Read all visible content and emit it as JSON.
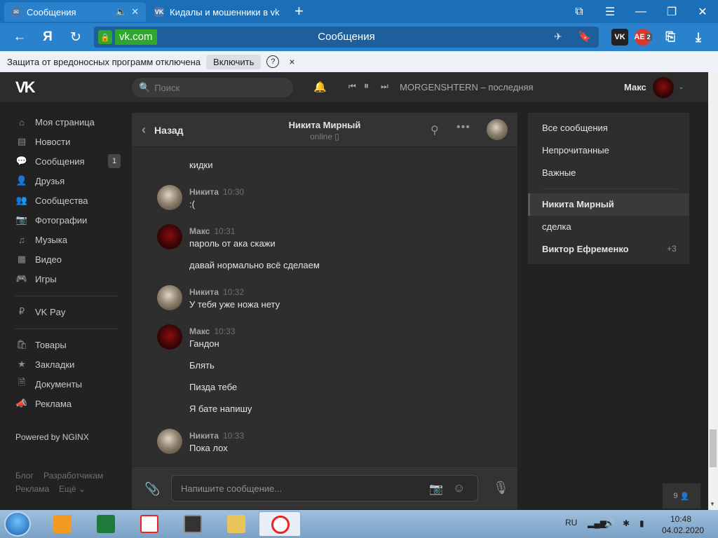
{
  "browser": {
    "tabs": [
      {
        "label": "Сообщения",
        "close": "✕"
      },
      {
        "label": "Кидалы и мошенники в vk"
      }
    ],
    "new_tab": "+",
    "logo": "Я",
    "url_domain": "vk.com",
    "page_title": "Сообщения",
    "ext_badge": "2",
    "ext_label": "AE"
  },
  "notice": {
    "text": "Защита от вредоносных программ отключена",
    "enable": "Включить",
    "help": "?",
    "close": "×"
  },
  "vk_header": {
    "search_placeholder": "Поиск",
    "track": "MORGENSHTERN – последняя",
    "user": "Макс"
  },
  "left_menu": {
    "items": [
      {
        "label": "Моя страница",
        "icon": "home-icon"
      },
      {
        "label": "Новости",
        "icon": "news-icon"
      },
      {
        "label": "Сообщения",
        "icon": "messages-icon",
        "badge": "1"
      },
      {
        "label": "Друзья",
        "icon": "friends-icon"
      },
      {
        "label": "Сообщества",
        "icon": "communities-icon"
      },
      {
        "label": "Фотографии",
        "icon": "photos-icon"
      },
      {
        "label": "Музыка",
        "icon": "music-icon"
      },
      {
        "label": "Видео",
        "icon": "video-icon"
      },
      {
        "label": "Игры",
        "icon": "games-icon"
      },
      {
        "label": "VK Pay",
        "icon": "vkpay-icon"
      },
      {
        "label": "Товары",
        "icon": "goods-icon"
      },
      {
        "label": "Закладки",
        "icon": "bookmarks-icon"
      },
      {
        "label": "Документы",
        "icon": "documents-icon"
      },
      {
        "label": "Реклама",
        "icon": "ads-icon"
      }
    ],
    "powered": "Powered by NGINX",
    "footer": [
      "Блог",
      "Разработчикам",
      "Реклама",
      "Ещё ⌄"
    ]
  },
  "chat": {
    "back": "Назад",
    "peer_name": "Никита Мирный",
    "peer_status": "online",
    "input_placeholder": "Напишите сообщение...",
    "messages": [
      {
        "text": "кидки"
      },
      {
        "author": "Никита",
        "time": "10:30",
        "text": ":("
      },
      {
        "author": "Макс",
        "time": "10:31",
        "text": "пароль от ака скажи"
      },
      {
        "text": "давай нормально всё сделаем"
      },
      {
        "author": "Никита",
        "time": "10:32",
        "text": "У тебя уже ножа нету"
      },
      {
        "author": "Макс",
        "time": "10:33",
        "text": "Гандон"
      },
      {
        "text": "Блять"
      },
      {
        "text": "Пизда тебе"
      },
      {
        "text": "Я бате напишу"
      },
      {
        "author": "Никита",
        "time": "10:33",
        "text": "Пока лох"
      }
    ]
  },
  "right_panel": {
    "filters": [
      "Все сообщения",
      "Непрочитанные",
      "Важные"
    ],
    "conversations": [
      "Никита Мирный",
      "сделка",
      "Виктор Ефременко"
    ],
    "extra_count": "+3"
  },
  "online_count": "9",
  "taskbar": {
    "lang": "RU",
    "time": "10:48",
    "date": "04.02.2020"
  }
}
